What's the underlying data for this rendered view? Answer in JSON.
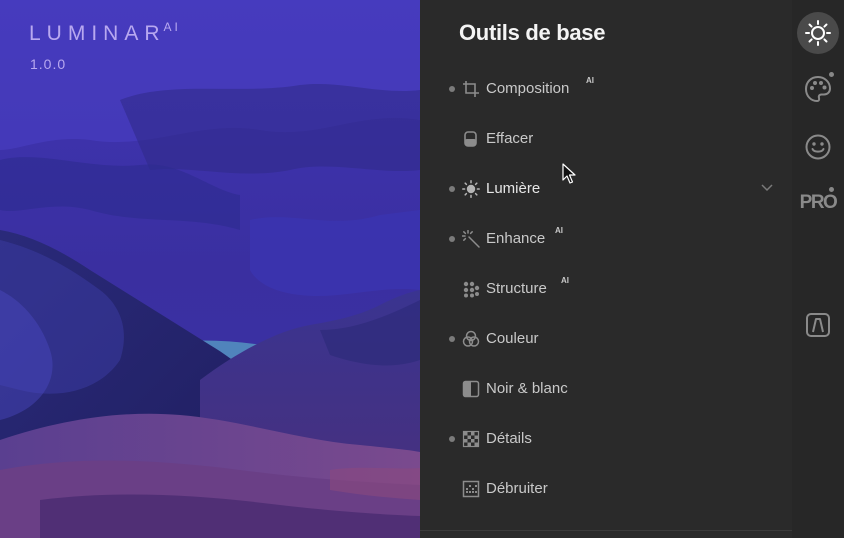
{
  "app": {
    "logo_word": "LUMINAR",
    "logo_sup": "AI",
    "version": "1.0.0"
  },
  "panel": {
    "title": "Outils de base",
    "tools": [
      {
        "name": "composition",
        "label": "Composition",
        "badge": "AI",
        "dot": true,
        "icon": "crop-icon"
      },
      {
        "name": "effacer",
        "label": "Effacer",
        "badge": "",
        "dot": false,
        "icon": "eraser-icon"
      },
      {
        "name": "lumiere",
        "label": "Lumière",
        "badge": "",
        "dot": true,
        "icon": "sun-icon",
        "expandable": true,
        "active": true
      },
      {
        "name": "enhance",
        "label": "Enhance",
        "badge": "AI",
        "dot": true,
        "icon": "magic-wand-icon"
      },
      {
        "name": "structure",
        "label": "Structure",
        "badge": "AI",
        "dot": false,
        "icon": "structure-dots-icon"
      },
      {
        "name": "couleur",
        "label": "Couleur",
        "badge": "",
        "dot": true,
        "icon": "color-circles-icon"
      },
      {
        "name": "noir-blanc",
        "label": "Noir & blanc",
        "badge": "",
        "dot": false,
        "icon": "black-white-icon"
      },
      {
        "name": "details",
        "label": "Détails",
        "badge": "",
        "dot": true,
        "icon": "checker-grid-icon"
      },
      {
        "name": "debruiter",
        "label": "Débruiter",
        "badge": "",
        "dot": false,
        "icon": "denoise-grid-icon"
      }
    ]
  },
  "rail": {
    "items": [
      {
        "name": "essentials",
        "icon": "sun-icon",
        "active": true
      },
      {
        "name": "creative",
        "icon": "palette-icon",
        "active": false
      },
      {
        "name": "portrait",
        "icon": "smiley-icon",
        "active": false
      },
      {
        "name": "pro",
        "icon": "pro-icon",
        "label": "PRO",
        "active": false
      },
      {
        "name": "templates",
        "icon": "templates-icon",
        "active": false
      }
    ]
  },
  "colors": {
    "accent_logo": "#b8a8f0",
    "panel_bg": "#2a2a2a",
    "sky": "#3c33a6"
  }
}
